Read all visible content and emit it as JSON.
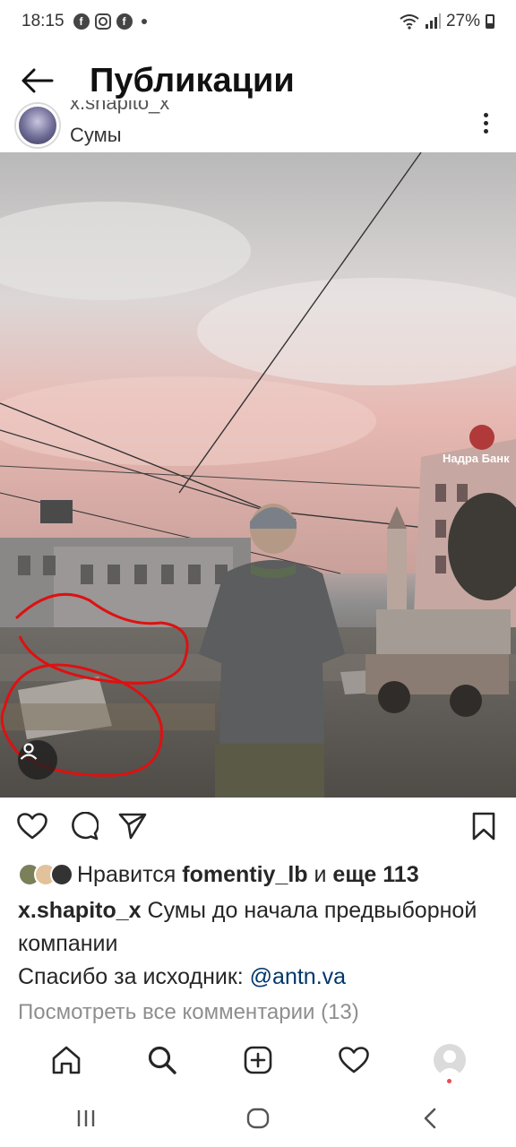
{
  "status_bar": {
    "time": "18:15",
    "battery": "27%"
  },
  "header": {
    "title": "Публикации"
  },
  "post": {
    "username": "x.shapito_x",
    "username_cut_display": "x.shapito_x",
    "location": "Сумы",
    "image_sign_text": "Надра Банк",
    "likes": {
      "prefix": "Нравится ",
      "user": "fomentiy_lb",
      "connector": " и ",
      "others": "еще 113"
    },
    "caption": {
      "username": "x.shapito_x",
      "line1": " Сумы до начала предвыборной компании",
      "line2_prefix": "Спасибо за исходник: ",
      "mention": "@antn.va"
    },
    "view_comments": "Посмотреть все комментарии (13)"
  },
  "icons": {
    "like": "heart-icon",
    "comment": "comment-icon",
    "share": "send-icon",
    "save": "bookmark-icon"
  }
}
